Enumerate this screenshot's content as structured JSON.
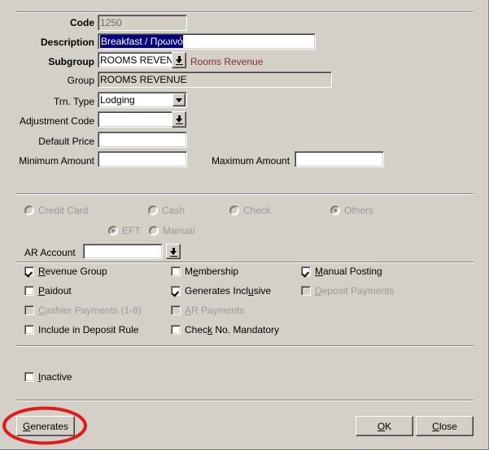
{
  "form": {
    "fields": [
      {
        "label": "Code",
        "value": "1250",
        "placeholder": ""
      },
      {
        "label": "Description",
        "value": "Breakfast / Πρωινό",
        "placeholder": ""
      },
      {
        "label": "Subgroup",
        "value": "ROOMS REVEN",
        "placeholder": ""
      },
      {
        "label": "Group",
        "value": "ROOMS REVENUE",
        "placeholder": ""
      },
      {
        "label": "Trn. Type",
        "value": "Lodging",
        "placeholder": ""
      },
      {
        "label": "Adjustment Code",
        "value": "",
        "placeholder": ""
      },
      {
        "label": "Default Price",
        "value": "",
        "placeholder": ""
      },
      {
        "label": "Minimum Amount",
        "value": "",
        "placeholder": ""
      },
      {
        "label": "Maximum Amount",
        "value": "",
        "placeholder": ""
      },
      {
        "label": "AR Account",
        "value": "",
        "placeholder": ""
      }
    ],
    "subgroup_note": "Rooms Revenue",
    "note_color": "#803030"
  },
  "payment_types": {
    "row1": [
      {
        "label": "Credit Card",
        "selected": false,
        "disabled": true
      },
      {
        "label": "Cash",
        "selected": false,
        "disabled": true
      },
      {
        "label": "Check",
        "selected": false,
        "disabled": true
      },
      {
        "label": "Others",
        "selected": true,
        "disabled": true
      }
    ],
    "row2": [
      {
        "label": "EFT",
        "selected": true,
        "disabled": true
      },
      {
        "label": "Manual",
        "selected": false,
        "disabled": true
      }
    ]
  },
  "options": {
    "col1": [
      {
        "label": "Revenue Group",
        "accel": "R",
        "checked": true,
        "disabled": false
      },
      {
        "label": "Paidout",
        "accel": "P",
        "checked": false,
        "disabled": false
      },
      {
        "label": "Cashier Payments (1-8)",
        "accel": "C",
        "checked": false,
        "disabled": true
      },
      {
        "label": "Include in Deposit Rule",
        "accel": "",
        "checked": false,
        "disabled": false
      }
    ],
    "col2": [
      {
        "label": "Membership",
        "accel": "e",
        "checked": false,
        "disabled": false
      },
      {
        "label": "Generates Inclusive",
        "accel": "u",
        "checked": true,
        "disabled": false
      },
      {
        "label": "AR Payments",
        "accel": "A",
        "checked": false,
        "disabled": true
      },
      {
        "label": "Check No. Mandatory",
        "accel": "k",
        "checked": false,
        "disabled": false
      }
    ],
    "col3": [
      {
        "label": "Manual Posting",
        "accel": "M",
        "checked": true,
        "disabled": false
      },
      {
        "label": "Deposit Payments",
        "accel": "D",
        "checked": false,
        "disabled": true
      }
    ],
    "inactive": {
      "label": "Inactive",
      "accel": "I",
      "checked": false,
      "disabled": false
    }
  },
  "buttons": {
    "generates": {
      "label": "Generates",
      "accel": "G"
    },
    "ok": {
      "label": "OK",
      "accel": "O"
    },
    "close": {
      "label": "Close",
      "accel": "C"
    }
  },
  "annotation": {
    "shape": "ellipse",
    "color": "#e01b1b",
    "targets": "generates-button"
  }
}
